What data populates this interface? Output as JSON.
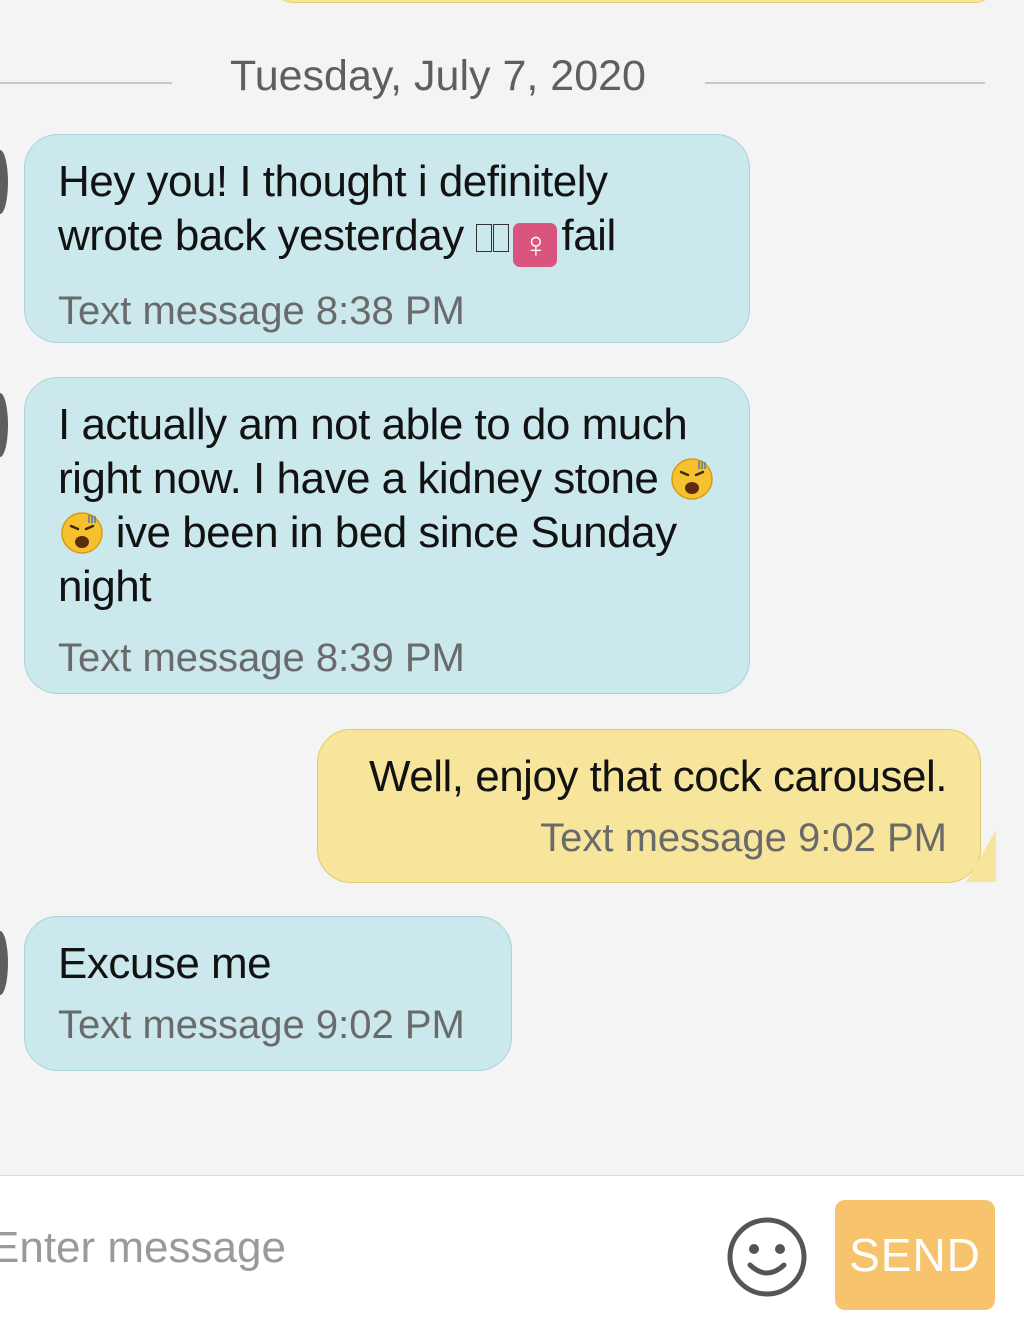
{
  "date_divider": "Tuesday, July 7, 2020",
  "messages": [
    {
      "direction": "incoming",
      "text_part1": "Hey you! I thought i definitely wrote back yesterday ",
      "emoji_sequence": [
        "unsupported-glyph-box",
        "unsupported-glyph-box",
        "female-sign"
      ],
      "female_sign": "♀",
      "text_part2": "fail",
      "meta": "Text message 8:38 PM"
    },
    {
      "direction": "incoming",
      "text_part1": "I actually am not able to do much right now. I have a kidney stone ",
      "emoji_sequence": [
        "weary-face-emoji",
        "weary-face-emoji"
      ],
      "text_part2": " ive been in bed since Sunday night",
      "meta": "Text message 8:39 PM"
    },
    {
      "direction": "outgoing",
      "text": "Well, enjoy that cock carousel.",
      "meta": "Text message 9:02 PM"
    },
    {
      "direction": "incoming",
      "text": "Excuse me",
      "meta": "Text message 9:02 PM"
    }
  ],
  "composer": {
    "placeholder": "Enter message",
    "value": "",
    "emoji_icon": "smiley-face-icon",
    "send_label": "SEND"
  },
  "colors": {
    "background": "#f4f4f4",
    "incoming_bubble": "#cbe8ed",
    "outgoing_bubble": "#f8e59c",
    "send_button": "#f8c36d",
    "meta_text": "#6a6a6a",
    "date_text": "#5f5f5f"
  }
}
